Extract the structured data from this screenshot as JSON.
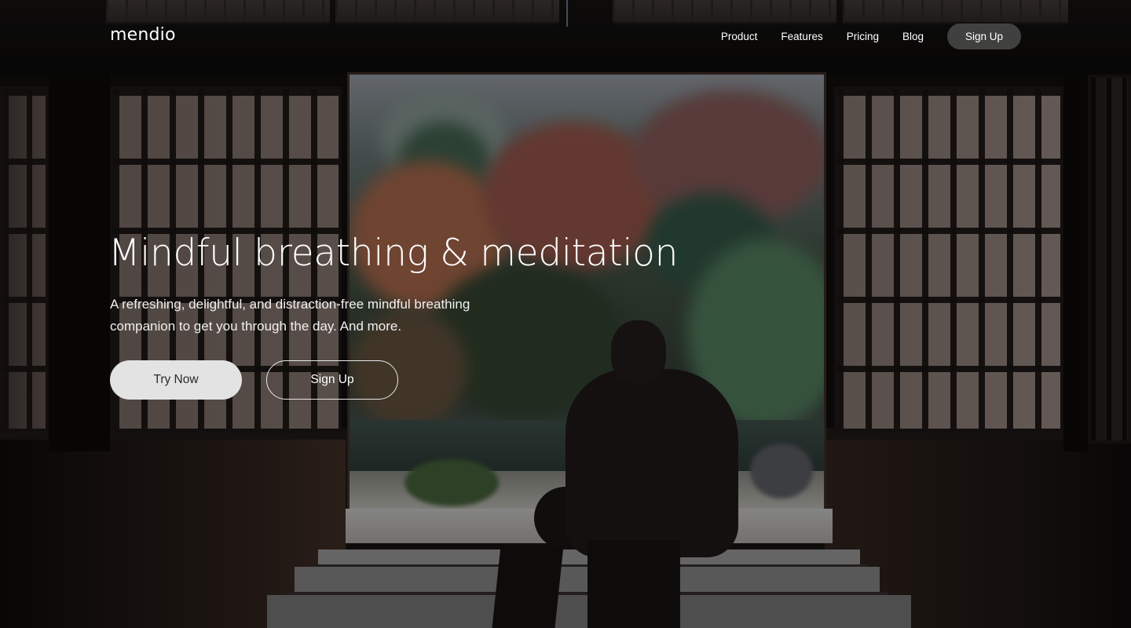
{
  "brand": {
    "logo_text": "mendio"
  },
  "nav": {
    "links": [
      "Product",
      "Features",
      "Pricing",
      "Blog"
    ],
    "cta_label": "Sign Up"
  },
  "hero": {
    "headline": "Mindful breathing & meditation",
    "subtext": "A refreshing, delightful, and distraction-free mindful breathing companion to get you through the day. And more.",
    "primary_button": "Try Now",
    "secondary_button": "Sign Up",
    "background_image": "photo of a person sitting in a dark Japanese room with shoji screens, looking out an open doorway at an autumn garden"
  },
  "colors": {
    "text": "#ffffff",
    "primary_button_bg": "#e4e3e3",
    "primary_button_text": "#2a2a2a",
    "nav_cta_bg": "rgba(110,110,110,0.55)"
  }
}
